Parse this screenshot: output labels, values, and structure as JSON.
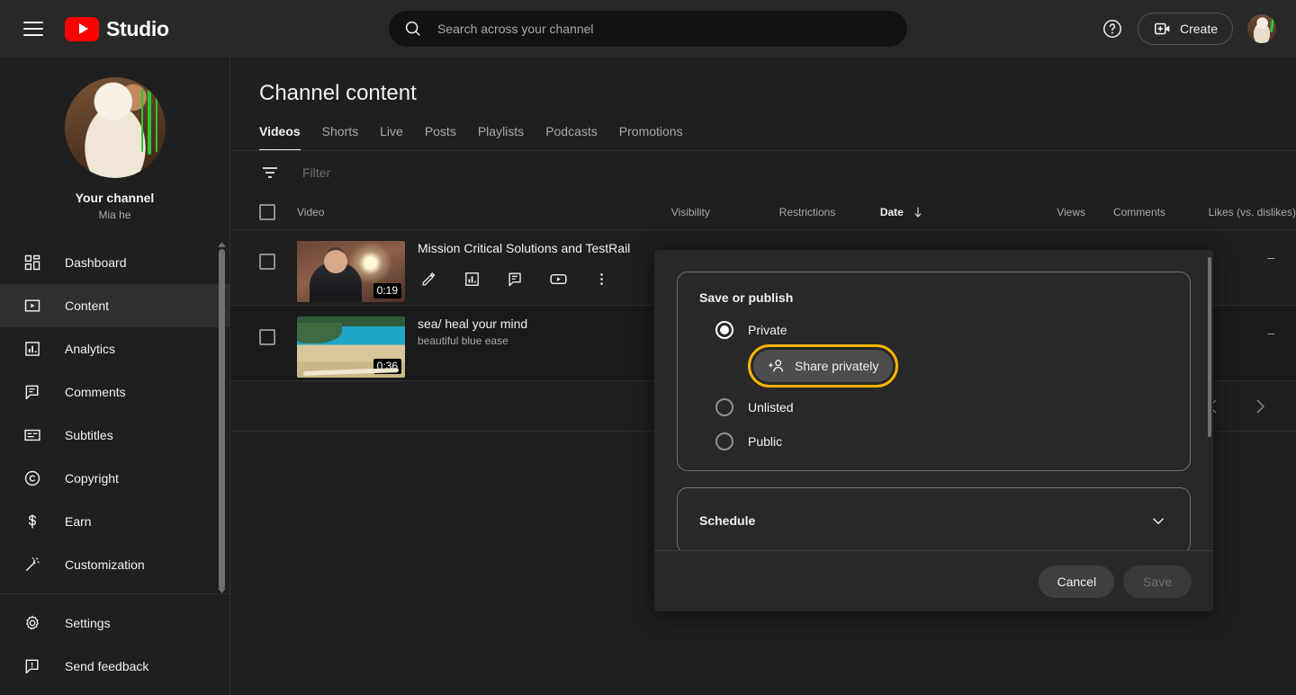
{
  "topbar": {
    "menu_icon": "hamburger-icon",
    "brand": "Studio",
    "logo_icon": "youtube-logo-icon",
    "search": {
      "placeholder": "Search across your channel",
      "value": "",
      "icon": "search-icon"
    },
    "help_icon": "help-circle-icon",
    "create_label": "Create",
    "create_icon": "create-video-icon",
    "avatar": "account-avatar"
  },
  "sidebar": {
    "channel_title": "Your channel",
    "channel_name": "Mia he",
    "items": [
      {
        "label": "Dashboard",
        "icon": "dashboard-icon",
        "active": false
      },
      {
        "label": "Content",
        "icon": "content-play-icon",
        "active": true
      },
      {
        "label": "Analytics",
        "icon": "analytics-bar-icon",
        "active": false
      },
      {
        "label": "Comments",
        "icon": "comments-icon",
        "active": false
      },
      {
        "label": "Subtitles",
        "icon": "subtitles-icon",
        "active": false
      },
      {
        "label": "Copyright",
        "icon": "copyright-icon",
        "active": false
      },
      {
        "label": "Earn",
        "icon": "earn-dollar-icon",
        "active": false
      },
      {
        "label": "Customization",
        "icon": "customization-wand-icon",
        "active": false
      }
    ],
    "footer_items": [
      {
        "label": "Settings",
        "icon": "gear-icon"
      },
      {
        "label": "Send feedback",
        "icon": "feedback-icon"
      }
    ]
  },
  "main": {
    "page_title": "Channel content",
    "tabs": [
      {
        "label": "Videos",
        "active": true
      },
      {
        "label": "Shorts",
        "active": false
      },
      {
        "label": "Live",
        "active": false
      },
      {
        "label": "Posts",
        "active": false
      },
      {
        "label": "Playlists",
        "active": false
      },
      {
        "label": "Podcasts",
        "active": false
      },
      {
        "label": "Promotions",
        "active": false
      }
    ],
    "filter": {
      "placeholder": "Filter",
      "value": "",
      "icon": "filter-icon"
    },
    "table": {
      "columns": {
        "video": "Video",
        "visibility": "Visibility",
        "restrictions": "Restrictions",
        "date": "Date",
        "date_sort_icon": "sort-descending-arrow-icon",
        "views": "Views",
        "comments": "Comments",
        "likes": "Likes (vs. dislikes)"
      },
      "rows": [
        {
          "title": "Mission Critical Solutions and TestRail",
          "description": "",
          "duration": "0:19",
          "visibility": "",
          "restrictions": "",
          "date": "",
          "views": "",
          "comments": "",
          "likes": "–",
          "actions": [
            "edit-pencil-icon",
            "analytics-bar-icon",
            "comments-icon",
            "youtube-play-icon",
            "more-options-icon"
          ]
        },
        {
          "title": "sea/ heal your mind",
          "description": "beautiful blue ease",
          "duration": "0:36",
          "visibility": "",
          "restrictions": "",
          "date": "",
          "views": "",
          "comments": "",
          "likes": "–",
          "actions": []
        }
      ]
    },
    "pagination": {
      "prev_icon": "chevron-left-icon",
      "next_icon": "chevron-right-icon"
    }
  },
  "modal": {
    "panel_title": "Save or publish",
    "options": [
      {
        "label": "Private",
        "selected": true
      },
      {
        "label": "Unlisted",
        "selected": false
      },
      {
        "label": "Public",
        "selected": false
      }
    ],
    "share_button": {
      "label": "Share privately",
      "icon": "add-person-icon",
      "highlighted": true
    },
    "schedule": {
      "label": "Schedule",
      "icon": "chevron-down-icon"
    },
    "cancel_label": "Cancel",
    "save_label": "Save",
    "highlight_color": "#ffb400"
  }
}
